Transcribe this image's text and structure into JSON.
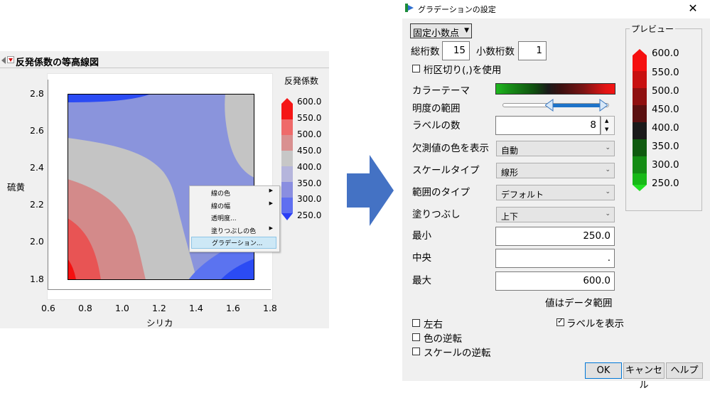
{
  "left": {
    "report_title": "反発係数の等高線図",
    "x_axis_title": "シリカ",
    "y_axis_title": "硫黄",
    "x_ticks": [
      "0.6",
      "0.8",
      "1.0",
      "1.2",
      "1.4",
      "1.6",
      "1.8"
    ],
    "y_ticks": [
      "2.8",
      "2.6",
      "2.4",
      "2.2",
      "2.0",
      "1.8"
    ],
    "legend_title": "反発係数",
    "legend_labels": [
      "600.0",
      "550.0",
      "500.0",
      "450.0",
      "400.0",
      "350.0",
      "300.0",
      "250.0"
    ],
    "legend_colors": [
      "#f51717",
      "#ef6a6a",
      "#d99090",
      "#c7c7c7",
      "#b5b5dc",
      "#8a8ee0",
      "#5f6ff0",
      "#2a3ef5"
    ],
    "contour_colors": {
      "blue": "#2b4bf4",
      "blue_mid": "#5b73f0",
      "lavender": "#8a94dc",
      "gray": "#c4c4c4",
      "pink": "#d38a8a",
      "salmon": "#e85454",
      "red": "#f51010"
    }
  },
  "context_menu": {
    "items": [
      {
        "label": "線の色",
        "has_submenu": true
      },
      {
        "label": "線の幅",
        "has_submenu": true
      },
      {
        "label": "透明度...",
        "has_submenu": false
      },
      {
        "label": "塗りつぶしの色",
        "has_submenu": true
      },
      {
        "label": "グラデーション...",
        "has_submenu": false,
        "highlighted": true
      }
    ]
  },
  "arrow_color": "#4472c4",
  "dialog": {
    "title": "グラデーションの設定",
    "close_glyph": "✕",
    "format_select": "固定小数点",
    "total_digits_label": "総桁数",
    "total_digits_value": "15",
    "decimal_digits_label": "小数桁数",
    "decimal_digits_value": "1",
    "thousands_sep_label": "桁区切り(,)を使用",
    "color_theme_label": "カラーテーマ",
    "color_theme_swatches": [
      "#1fb81f",
      "#178c17",
      "#136e13",
      "#0f4f0f",
      "#1a1a1a",
      "#3a1010",
      "#5a1212",
      "#7d1414",
      "#b51414",
      "#e01414",
      "#f51414"
    ],
    "brightness_label": "明度の範囲",
    "labels_count_label": "ラベルの数",
    "labels_count_value": "8",
    "missing_color_label": "欠測値の色を表示",
    "missing_color_value": "自動",
    "scale_type_label": "スケールタイプ",
    "scale_type_value": "線形",
    "range_type_label": "範囲のタイプ",
    "range_type_value": "デフォルト",
    "fill_label": "塗りつぶし",
    "fill_value": "上下",
    "min_label": "最小",
    "min_value": "250.0",
    "center_label": "中央",
    "center_value": ".",
    "max_label": "最大",
    "max_value": "600.0",
    "range_note": "値はデータ範囲",
    "lr_label": "左右",
    "show_labels_label": "ラベルを表示",
    "show_labels_checked": true,
    "reverse_colors_label": "色の逆転",
    "reverse_scale_label": "スケールの逆転",
    "ok_label": "OK",
    "cancel_label": "キャンセル",
    "help_label": "ヘルプ",
    "preview_title": "プレビュー",
    "preview_labels": [
      "600.0",
      "550.0",
      "500.0",
      "450.0",
      "400.0",
      "350.0",
      "300.0",
      "250.0"
    ],
    "preview_colors": [
      "#f50f0f",
      "#c81010",
      "#8f1010",
      "#5a1010",
      "#1a1a1a",
      "#0f5a0f",
      "#148c14",
      "#17b817",
      "#22e022"
    ]
  }
}
